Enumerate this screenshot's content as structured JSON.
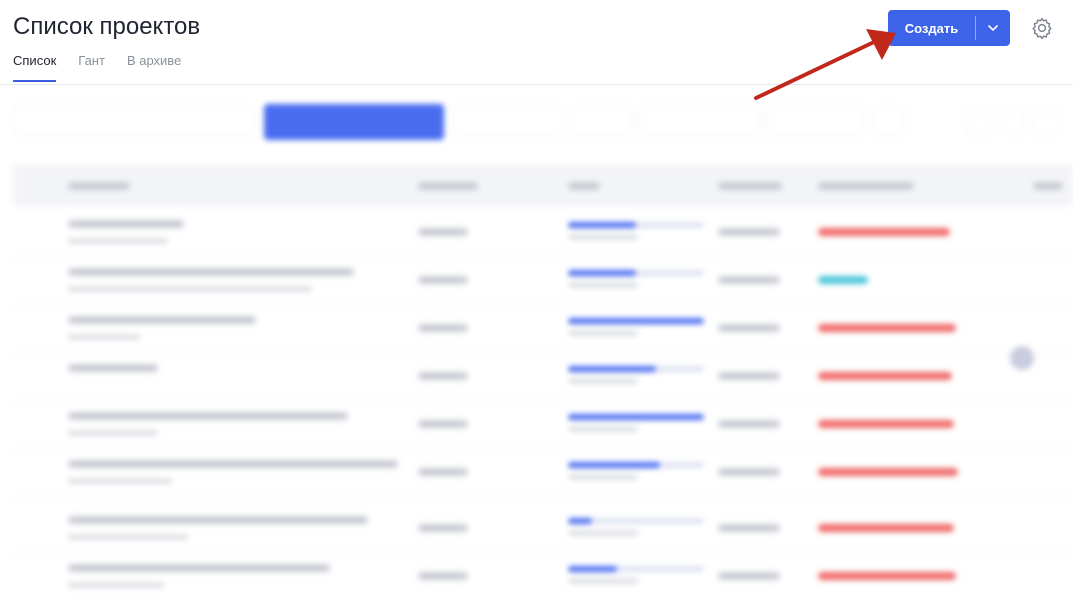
{
  "header": {
    "title": "Список проектов",
    "tabs": [
      {
        "label": "Список",
        "active": true
      },
      {
        "label": "Гант",
        "active": false
      },
      {
        "label": "В архиве",
        "active": false
      }
    ],
    "create_label": "Создать",
    "icons": {
      "dropdown": "chevron-down-icon",
      "settings": "gear-icon"
    }
  },
  "colors": {
    "accent": "#3d63e8",
    "overdue": "#f06a6a",
    "on_time": "#4cc7d8",
    "annotation_arrow": "#c0281c"
  }
}
